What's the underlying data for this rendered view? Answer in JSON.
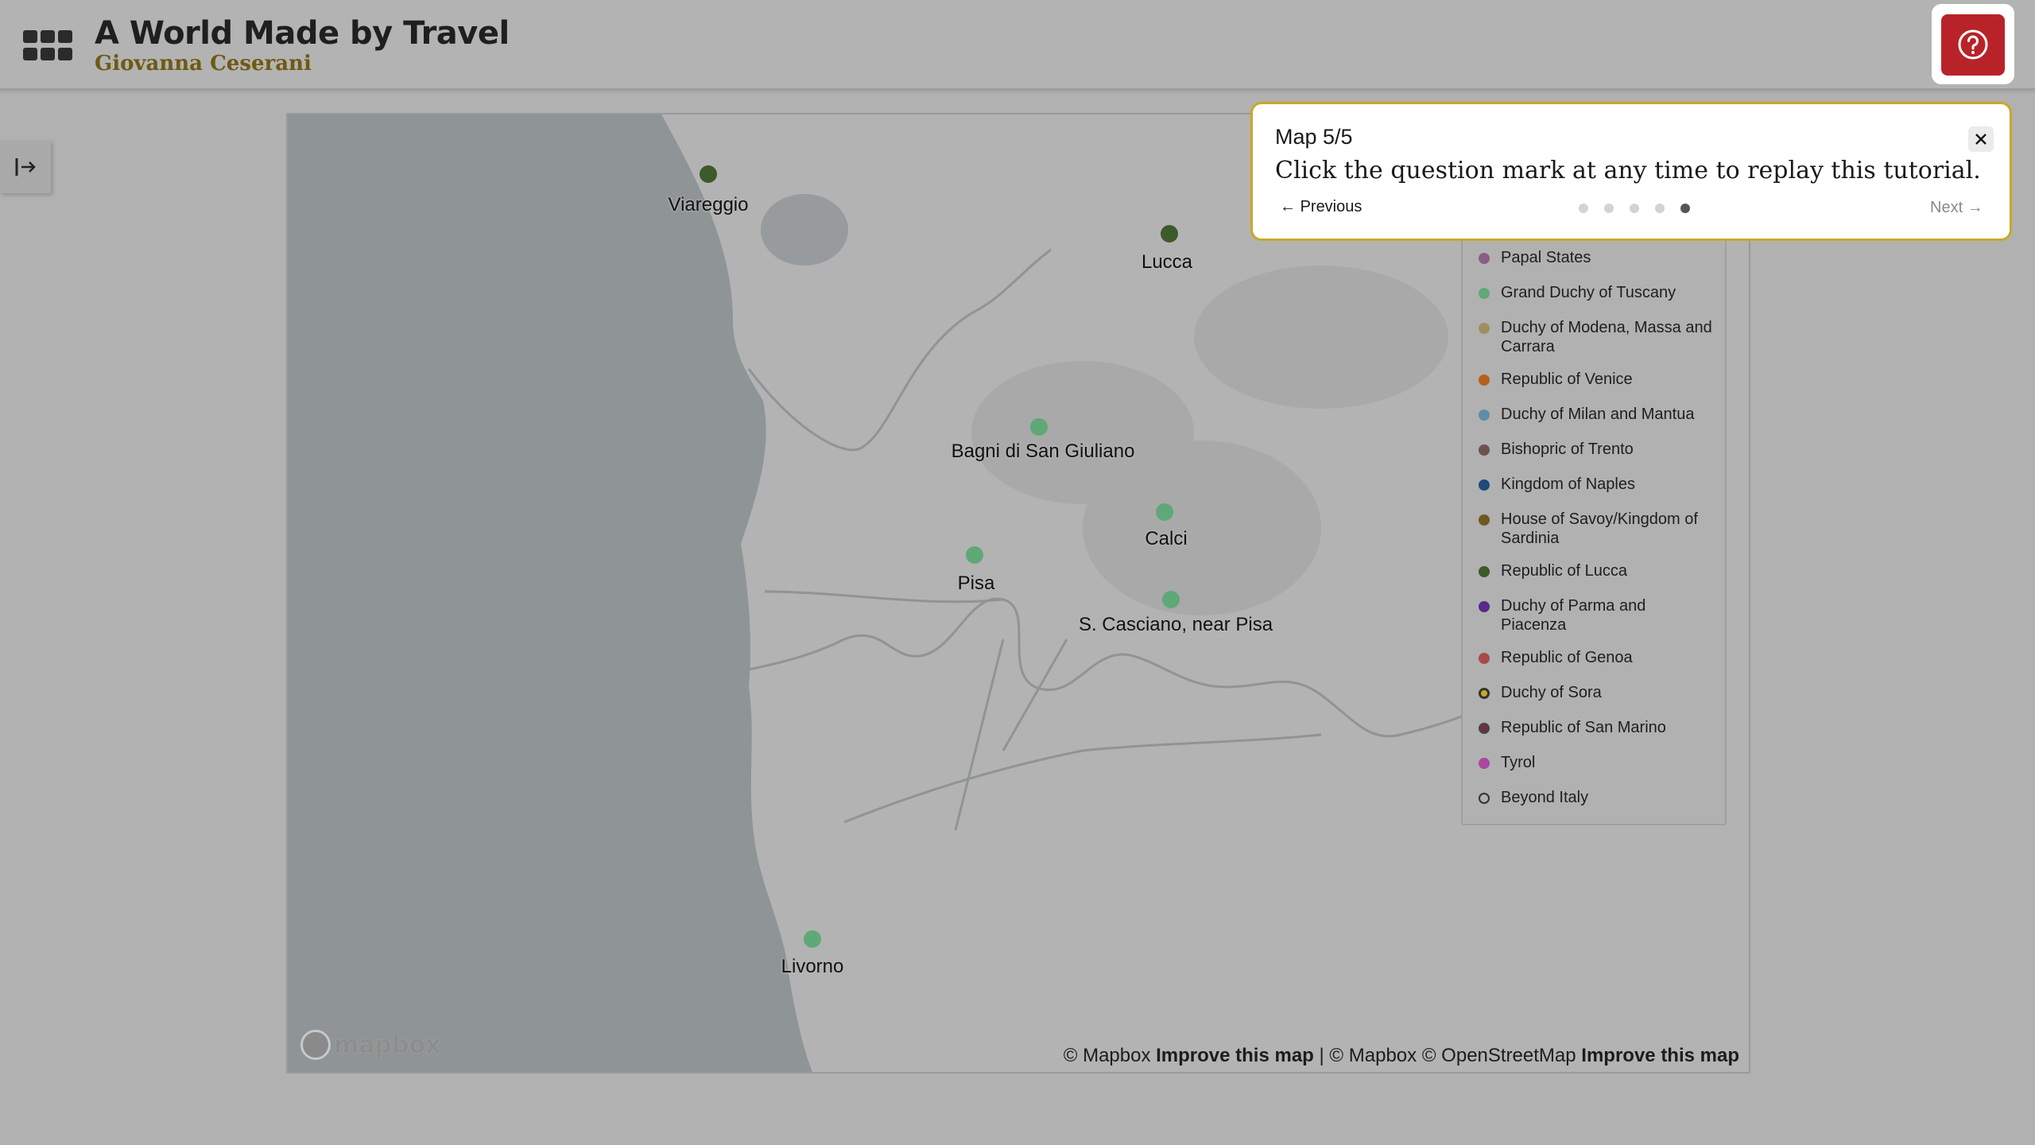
{
  "header": {
    "title": "A World Made by Travel",
    "subtitle": "Giovanna Ceserani",
    "help_icon": "question-circle-icon",
    "menu_icon": "grid-icon"
  },
  "sidebar_toggle": {
    "icon": "panel-expand-icon"
  },
  "map": {
    "places": [
      {
        "name": "Viareggio",
        "color": "#3d5a2a"
      },
      {
        "name": "Lucca",
        "color": "#3d5a2a"
      },
      {
        "name": "Bagni di San Giuliano",
        "color": "#5fa878"
      },
      {
        "name": "Calci",
        "color": "#5fa878"
      },
      {
        "name": "Pisa",
        "color": "#5fa878"
      },
      {
        "name": "S. Casciano, near Pisa",
        "color": "#5fa878"
      },
      {
        "name": "Livorno",
        "color": "#5fa878"
      }
    ],
    "logo_text": "mapbox",
    "attribution": {
      "part1": "© Mapbox",
      "link1": "Improve this map",
      "separator": "| © Mapbox © OpenStreetMap",
      "link2": "Improve this map"
    }
  },
  "legend": {
    "items": [
      {
        "label": "Papal States",
        "color": "#8a5e86"
      },
      {
        "label": "Grand Duchy of Tuscany",
        "color": "#5fa878"
      },
      {
        "label": "Duchy of Modena, Massa and Carrara",
        "color": "#a08e62"
      },
      {
        "label": "Republic of Venice",
        "color": "#b4621e"
      },
      {
        "label": "Duchy of Milan and Mantua",
        "color": "#5f8ea8"
      },
      {
        "label": "Bishopric of Trento",
        "color": "#6e5250"
      },
      {
        "label": "Kingdom of Naples",
        "color": "#1e4a7a"
      },
      {
        "label": "House of Savoy/Kingdom of Sardinia",
        "color": "#6e5a1e"
      },
      {
        "label": "Republic of Lucca",
        "color": "#3d5a2a"
      },
      {
        "label": "Duchy of Parma and Piacenza",
        "color": "#5a2a8a"
      },
      {
        "label": "Republic of Genoa",
        "color": "#a84a4a"
      },
      {
        "label": "Duchy of Sora",
        "color": "#6e5a1e"
      },
      {
        "label": "Republic of San Marino",
        "color": "#7a2a3a"
      },
      {
        "label": "Tyrol",
        "color": "#a848a0"
      },
      {
        "label": "Beyond Italy",
        "color": "none"
      }
    ]
  },
  "tour": {
    "step": "Map 5/5",
    "text": "Click the question mark at any time to replay this tutorial.",
    "prev_label": "Previous",
    "next_label": "Next",
    "total_steps": 5,
    "current_step": 5,
    "close_icon": "close-icon"
  }
}
